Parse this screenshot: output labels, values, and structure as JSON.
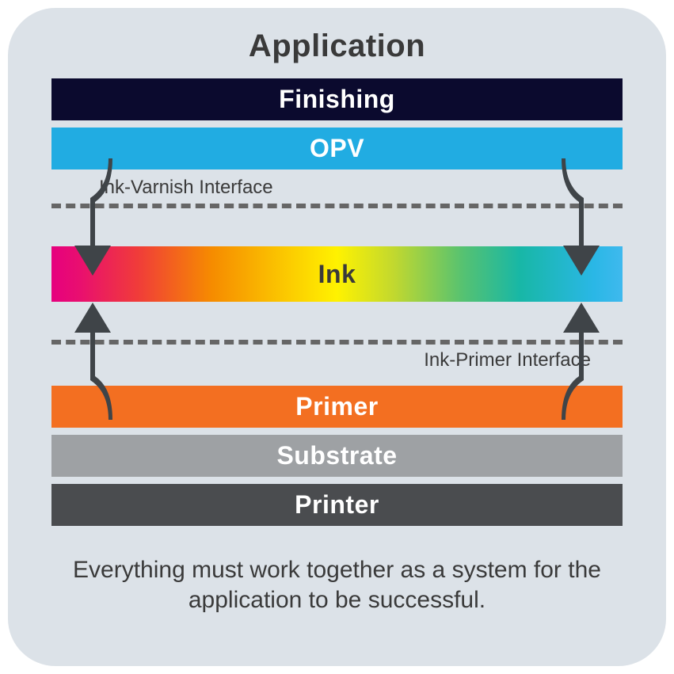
{
  "title": "Application",
  "layers": {
    "finishing": "Finishing",
    "opv": "OPV",
    "ink": "Ink",
    "primer": "Primer",
    "substrate": "Substrate",
    "printer": "Printer"
  },
  "interfaces": {
    "varnish": "Ink-Varnish Interface",
    "primer": "Ink-Primer Interface"
  },
  "footer": "Everything must work together as a system for the application to be successful.",
  "colors": {
    "finishing": "#0b0a2e",
    "opv": "#21ace2",
    "primer": "#f36f21",
    "substrate": "#9ea1a4",
    "printer": "#4a4c4f",
    "arrow": "#3f4448"
  }
}
